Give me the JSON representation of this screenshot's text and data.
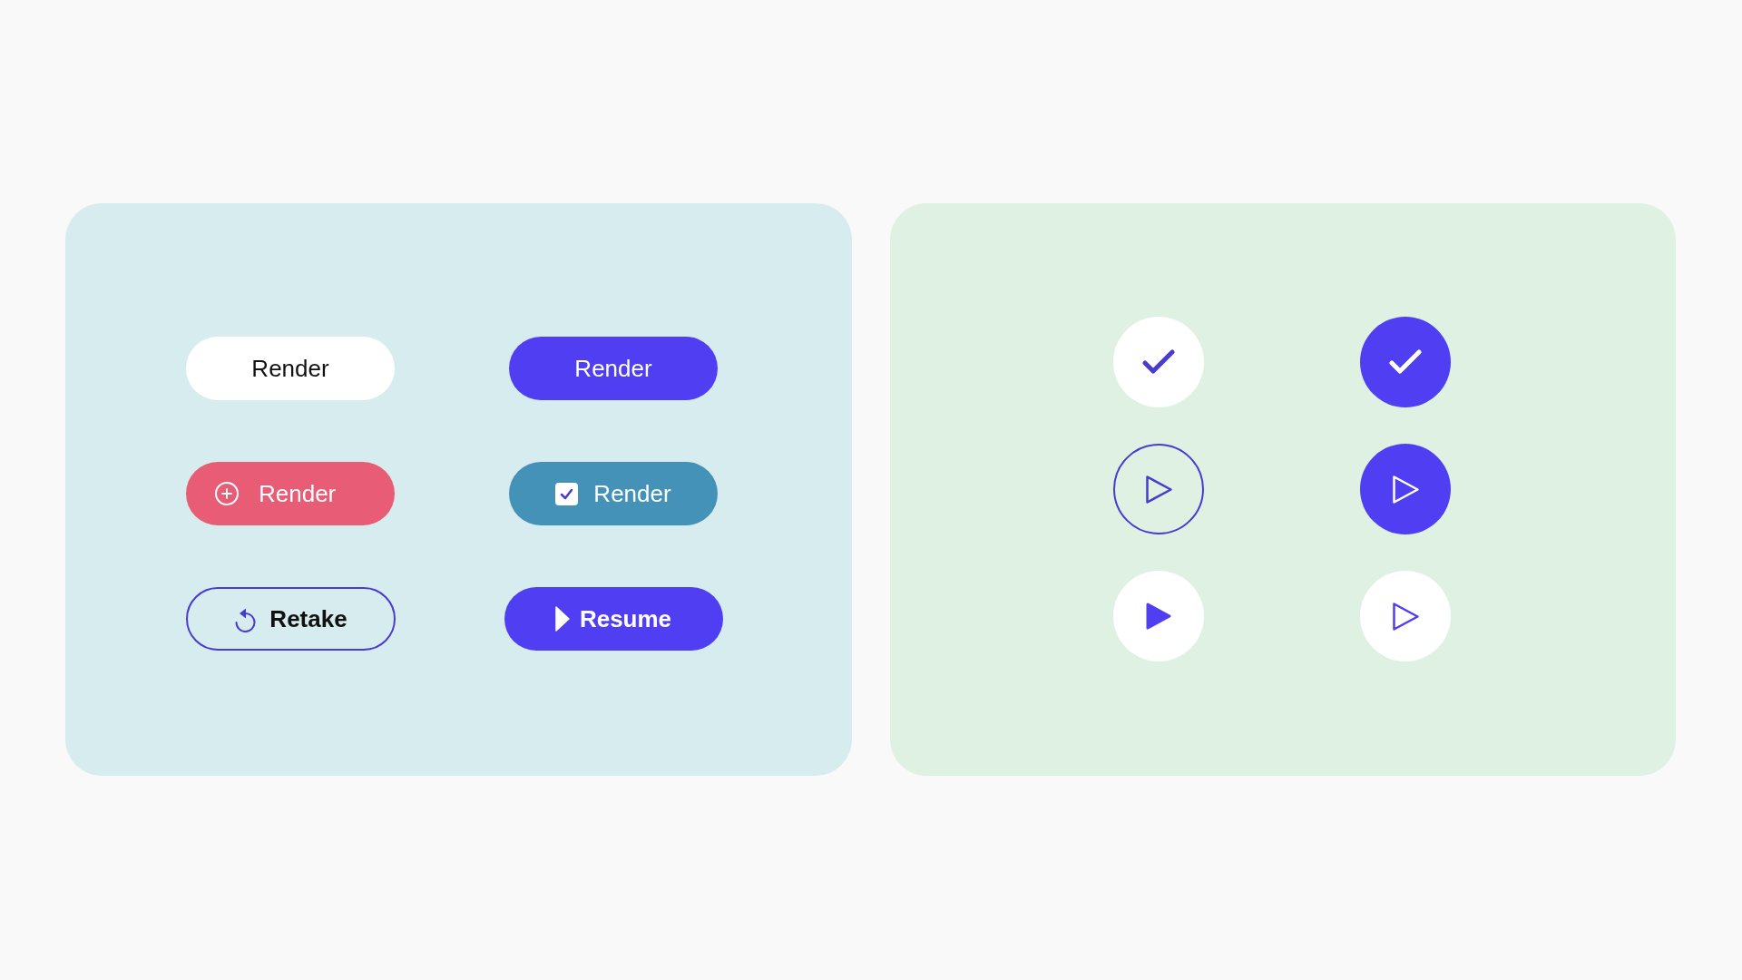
{
  "left_panel": {
    "buttons": [
      {
        "label": "Render",
        "kind": "plain"
      },
      {
        "label": "Render",
        "kind": "primary"
      },
      {
        "label": "Render",
        "kind": "add"
      },
      {
        "label": "Render",
        "kind": "checkbox",
        "checked": true
      },
      {
        "label": "Retake",
        "kind": "outline"
      },
      {
        "label": "Resume",
        "kind": "play"
      }
    ]
  },
  "right_panel": {
    "icon_buttons": [
      {
        "kind": "check-light"
      },
      {
        "kind": "check-filled"
      },
      {
        "kind": "play-ring"
      },
      {
        "kind": "play-filled"
      },
      {
        "kind": "play-solid-light"
      },
      {
        "kind": "play-light"
      }
    ]
  }
}
